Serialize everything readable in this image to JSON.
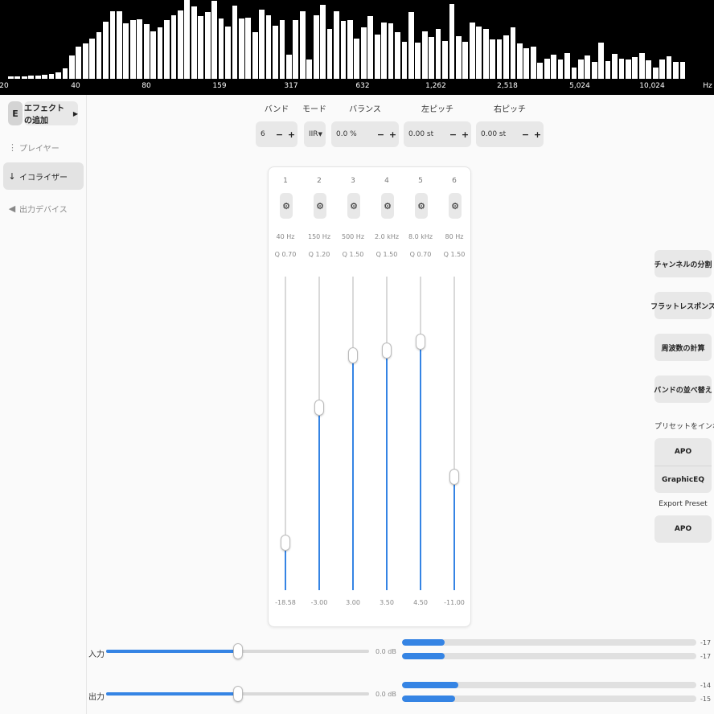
{
  "spectrum": {
    "axis_labels": [
      "20",
      "40",
      "80",
      "159",
      "317",
      "632",
      "1,262",
      "2,518",
      "5,024",
      "10,024",
      "Hz"
    ],
    "levels": [
      3,
      3,
      3,
      4,
      4,
      5,
      6,
      8,
      13,
      30,
      41,
      45,
      51,
      59,
      72,
      86,
      86,
      70,
      75,
      76,
      69,
      60,
      65,
      74,
      81,
      87,
      102,
      92,
      80,
      85,
      99,
      77,
      66,
      93,
      77,
      78,
      59,
      88,
      81,
      67,
      74,
      31,
      75,
      86,
      25,
      81,
      94,
      63,
      86,
      73,
      74,
      51,
      65,
      80,
      56,
      71,
      70,
      59,
      47,
      85,
      46,
      60,
      53,
      63,
      48,
      95,
      54,
      47,
      71,
      66,
      63,
      50,
      50,
      55,
      65,
      45,
      39,
      41,
      20,
      26,
      31,
      25,
      33,
      14,
      25,
      30,
      21,
      46,
      22,
      32,
      26,
      24,
      28,
      33,
      23,
      14,
      24,
      29,
      21,
      21
    ]
  },
  "sidebar": {
    "logo": "E",
    "add_effect": "エフェクトの追加",
    "items": [
      {
        "label": "プレイヤー"
      },
      {
        "label": "イコライザー"
      },
      {
        "label": "出力デバイス"
      }
    ]
  },
  "controls": {
    "bands": {
      "title": "バンド",
      "value": "6"
    },
    "mode": {
      "title": "モード",
      "value": "IIR"
    },
    "balance": {
      "title": "バランス",
      "value": "0.0 %"
    },
    "left_pitch": {
      "title": "左ピッチ",
      "value": "0.00 st"
    },
    "right_pitch": {
      "title": "右ピッチ",
      "value": "0.00 st"
    }
  },
  "eq": {
    "gain_range_db": [
      -24,
      12
    ],
    "bands": [
      {
        "num": "1",
        "freq": "40 Hz",
        "q": "Q 0.70",
        "gain": "-18.58"
      },
      {
        "num": "2",
        "freq": "150 Hz",
        "q": "Q 1.20",
        "gain": "-3.00"
      },
      {
        "num": "3",
        "freq": "500 Hz",
        "q": "Q 1.50",
        "gain": "3.00"
      },
      {
        "num": "4",
        "freq": "2.0 kHz",
        "q": "Q 1.50",
        "gain": "3.50"
      },
      {
        "num": "5",
        "freq": "8.0 kHz",
        "q": "Q 0.70",
        "gain": "4.50"
      },
      {
        "num": "6",
        "freq": "80 Hz",
        "q": "Q 1.50",
        "gain": "-11.00"
      }
    ]
  },
  "right_panel": {
    "split_channels": "チャンネルの分割",
    "flat_response": "フラットレスポンス",
    "calc_freqs": "周波数の計算",
    "sort_bands": "バンドの並べ替え",
    "import_label": "プリセットをインポート",
    "import_apo": "APO",
    "import_geq": "GraphicEQ",
    "export_label": "Export Preset",
    "export_apo": "APO"
  },
  "io": {
    "input": {
      "label": "入力",
      "value": "0.0 dB",
      "slider_fraction": 0.5,
      "meters": [
        {
          "fraction": 0.145,
          "value": "-17"
        },
        {
          "fraction": 0.145,
          "value": "-17"
        }
      ]
    },
    "output": {
      "label": "出力",
      "value": "0.0 dB",
      "slider_fraction": 0.5,
      "meters": [
        {
          "fraction": 0.19,
          "value": "-14"
        },
        {
          "fraction": 0.18,
          "value": "-15"
        }
      ]
    }
  },
  "colors": {
    "accent": "#3584e4",
    "spectrum_bg": "#000000",
    "spectrum_bar": "#ffffff"
  }
}
